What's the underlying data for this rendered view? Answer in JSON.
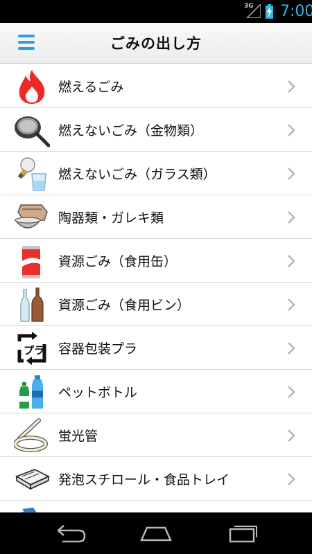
{
  "status_bar": {
    "network": "3G",
    "time": "7:00"
  },
  "header": {
    "title": "ごみの出し方",
    "menu_icon": "hamburger-menu-icon"
  },
  "colors": {
    "accent": "#2a9fe0",
    "time": "#33b5e5",
    "chevron": "#b5b5b5"
  },
  "items": [
    {
      "label": "燃えるごみ",
      "icon": "fire-icon"
    },
    {
      "label": "燃えないごみ（金物類）",
      "icon": "frying-pan-icon"
    },
    {
      "label": "燃えないごみ（ガラス類）",
      "icon": "light-bulb-glass-icon"
    },
    {
      "label": "陶器類・ガレキ類",
      "icon": "pottery-icon"
    },
    {
      "label": "資源ごみ（食用缶）",
      "icon": "can-icon"
    },
    {
      "label": "資源ごみ（食用ビン）",
      "icon": "bottle-icon"
    },
    {
      "label": "容器包装プラ",
      "icon": "plastic-recycle-icon"
    },
    {
      "label": "ペットボトル",
      "icon": "pet-bottle-icon"
    },
    {
      "label": "蛍光管",
      "icon": "fluorescent-tube-icon"
    },
    {
      "label": "発泡スチロール・食品トレイ",
      "icon": "food-tray-icon"
    },
    {
      "label": "",
      "icon": "paper-pack-icon"
    }
  ],
  "nav_bar": {
    "back_icon": "back-icon",
    "home_icon": "home-icon",
    "recent_icon": "recent-apps-icon"
  }
}
